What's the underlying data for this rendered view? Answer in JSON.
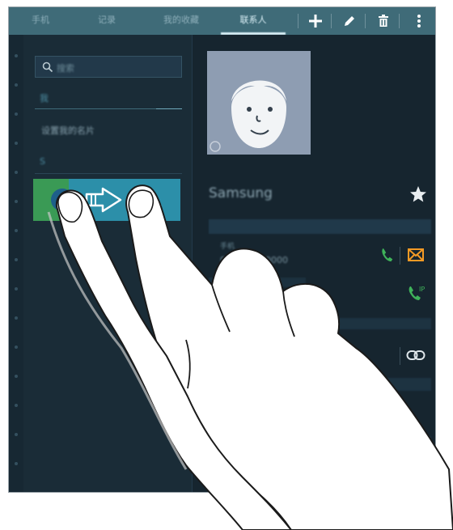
{
  "topbar": {
    "tabs": [
      {
        "label": "手机"
      },
      {
        "label": "记录"
      },
      {
        "label": "我的收藏"
      },
      {
        "label": "联系人"
      }
    ],
    "actions": [
      {
        "icon": "plus-icon"
      },
      {
        "icon": "pencil-icon"
      },
      {
        "icon": "trash-icon"
      },
      {
        "icon": "more-vertical-icon"
      }
    ]
  },
  "left": {
    "search_placeholder": "搜索",
    "section_label": "我",
    "profile_label": "设置我的名片",
    "group_label": "S"
  },
  "right": {
    "contact_name": "Samsung",
    "star_icon": "star-icon",
    "field_label": "手机",
    "phone_value": "000 0000 0000"
  },
  "colors": {
    "accent": "#3f6b78",
    "call_green": "#3a9a55",
    "swipe_blue": "#2c8fa9",
    "message_orange": "#f59a25"
  }
}
